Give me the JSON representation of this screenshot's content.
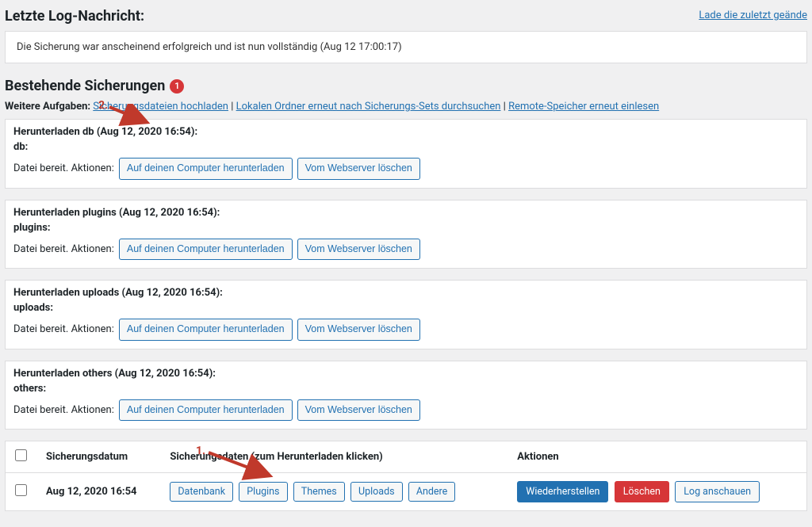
{
  "header": {
    "log_title": "Letzte Log-Nachricht:",
    "reload_link": "Lade die zuletzt geände",
    "log_message": "Die Sicherung war anscheinend erfolgreich und ist nun vollständig (Aug 12 17:00:17)"
  },
  "existing": {
    "title": "Bestehende Sicherungen",
    "badge": "1"
  },
  "tasks": {
    "label": "Weitere Aufgaben:",
    "link_upload": "Sicherungsdateien hochladen",
    "sep": " | ",
    "link_rescan": "Lokalen Ordner erneut nach Sicherungs-Sets durchsuchen",
    "link_remote": "Remote-Speicher erneut einlesen"
  },
  "annotations": {
    "n1": "1.",
    "n2": "2."
  },
  "common": {
    "file_ready": "Datei bereit. Aktionen:",
    "btn_download": "Auf deinen Computer herunterladen",
    "btn_delete_ws": "Vom Webserver löschen"
  },
  "boxes": [
    {
      "title": "Herunterladen db (Aug 12, 2020 16:54):",
      "sub": "db:"
    },
    {
      "title": "Herunterladen plugins (Aug 12, 2020 16:54):",
      "sub": "plugins:"
    },
    {
      "title": "Herunterladen uploads (Aug 12, 2020 16:54):",
      "sub": "uploads:"
    },
    {
      "title": "Herunterladen others (Aug 12, 2020 16:54):",
      "sub": "others:"
    }
  ],
  "table": {
    "head_date": "Sicherungsdatum",
    "head_data": "Sicherungsdaten (zum Herunterladen klicken)",
    "head_actions": "Aktionen",
    "row": {
      "date": "Aug 12, 2020 16:54",
      "pills": {
        "db": "Datenbank",
        "plugins": "Plugins",
        "themes": "Themes",
        "uploads": "Uploads",
        "others": "Andere"
      },
      "actions": {
        "restore": "Wiederherstellen",
        "delete": "Löschen",
        "log": "Log anschauen"
      }
    }
  }
}
